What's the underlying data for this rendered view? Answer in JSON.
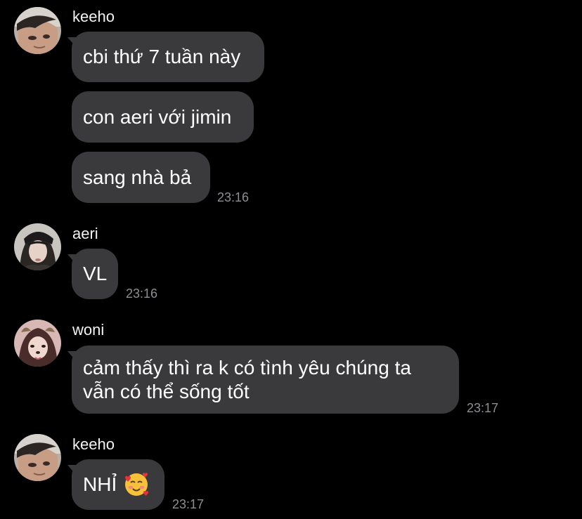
{
  "colors": {
    "background": "#000000",
    "bubble": "#3a3a3c",
    "text": "#ffffff",
    "timestamp": "#8e8e93"
  },
  "messages": [
    {
      "sender": "keeho",
      "avatar_icon": "keeho-avatar",
      "bubbles": [
        "cbi thứ 7 tuần này",
        "con aeri với jimin",
        "sang nhà bả"
      ],
      "time": "23:16"
    },
    {
      "sender": "aeri",
      "avatar_icon": "aeri-avatar",
      "bubbles": [
        "VL"
      ],
      "time": "23:16"
    },
    {
      "sender": "woni",
      "avatar_icon": "woni-avatar",
      "bubbles": [
        [
          "cảm thấy thì ra k có tình yêu chúng ta",
          "vẫn có thể sống tốt"
        ]
      ],
      "time": "23:17"
    },
    {
      "sender": "keeho",
      "avatar_icon": "keeho-avatar",
      "bubbles": [
        "NHỈ"
      ],
      "emoji": "smiling-face-with-hearts-icon",
      "time": "23:17"
    }
  ]
}
